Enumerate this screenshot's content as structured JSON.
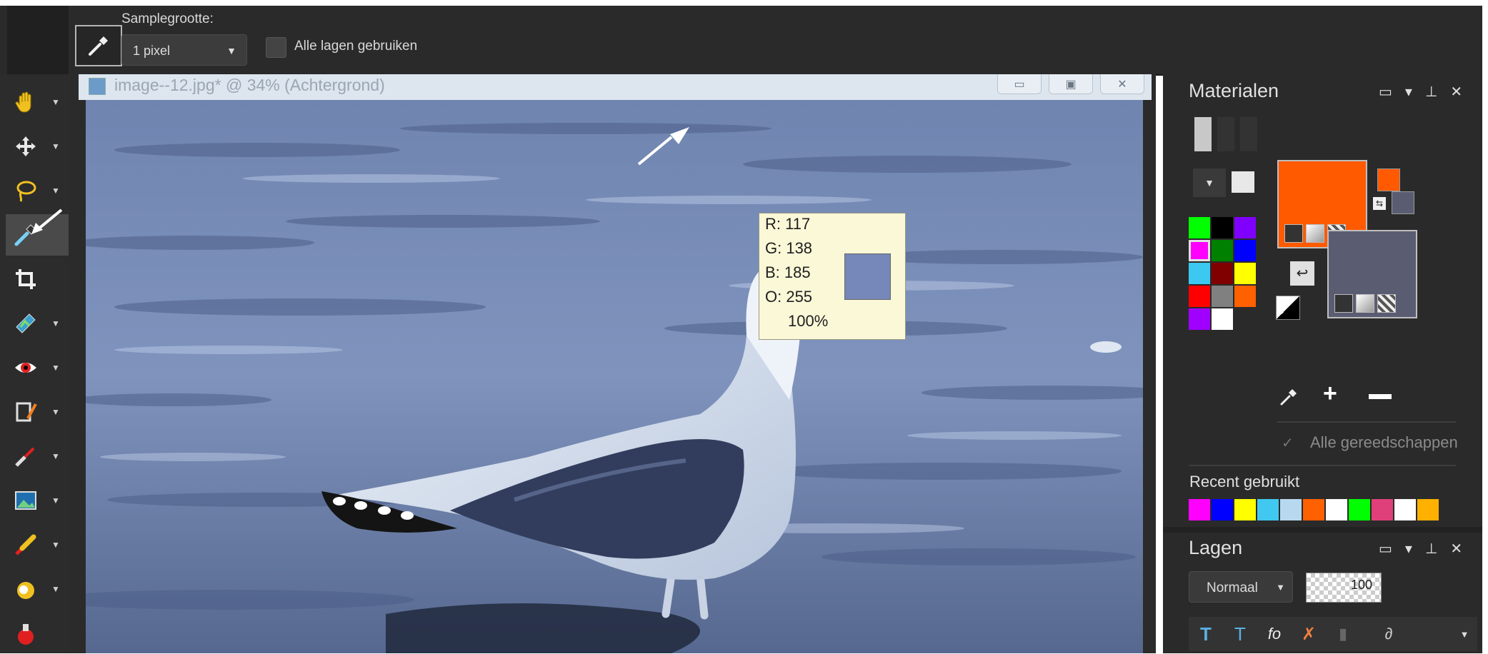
{
  "option_bar": {
    "tool_icon": "eyedropper-icon",
    "sample_size_label": "Samplegrootte:",
    "sample_size_value": "1 pixel",
    "all_layers_label": "Alle lagen gebruiken",
    "all_layers_checked": false
  },
  "toolbar": {
    "tools": [
      {
        "name": "pan",
        "icon": "hand-icon"
      },
      {
        "name": "move",
        "icon": "move-arrows-icon"
      },
      {
        "name": "lasso",
        "icon": "lasso-icon"
      },
      {
        "name": "eyedropper",
        "icon": "eyedropper-icon",
        "active": true
      },
      {
        "name": "crop",
        "icon": "crop-icon"
      },
      {
        "name": "straighten",
        "icon": "photo-correct-icon"
      },
      {
        "name": "red-eye",
        "icon": "eye-icon"
      },
      {
        "name": "makeover",
        "icon": "makeover-icon"
      },
      {
        "name": "clone",
        "icon": "clone-brush-icon"
      },
      {
        "name": "picture-frame",
        "icon": "picture-icon"
      },
      {
        "name": "paint-brush",
        "icon": "brush-icon"
      },
      {
        "name": "dodge",
        "icon": "dodge-icon"
      },
      {
        "name": "airbrush",
        "icon": "airbrush-icon"
      }
    ]
  },
  "document": {
    "title": "image--12.jpg* @  34% (Achtergrond)",
    "tooltip": {
      "r": "R: 117",
      "g": "G: 138",
      "b": "B: 185",
      "o": "O: 255",
      "pct": "100%",
      "color": "#7588b9"
    }
  },
  "materials": {
    "title": "Materialen",
    "fg_color": "#ff5a00",
    "bg_color": "#5a5d72",
    "mini_fg": "#ff5a00",
    "mini_bg": "#5a5d72",
    "palette": [
      "#00ff00",
      "#000000",
      "#8000ff",
      "#ff00ff",
      "#008000",
      "#0000ff",
      "#3cc8f0",
      "#800000",
      "#ffff00",
      "#ff0000",
      "#808080",
      "#ff6000",
      "#a000ff",
      "#ffffff"
    ],
    "all_tools_label": "Alle gereedschappen",
    "recent_label": "Recent gebruikt",
    "recent": [
      "#ff00ff",
      "#0000ff",
      "#ffff00",
      "#40c8f0",
      "#b8d8f0",
      "#ff6000",
      "#ffffff",
      "#00ff00",
      "#e0407a",
      "#ffffff",
      "#ffb000"
    ]
  },
  "layers": {
    "title": "Lagen",
    "blend_mode": "Normaal",
    "opacity": "100"
  }
}
